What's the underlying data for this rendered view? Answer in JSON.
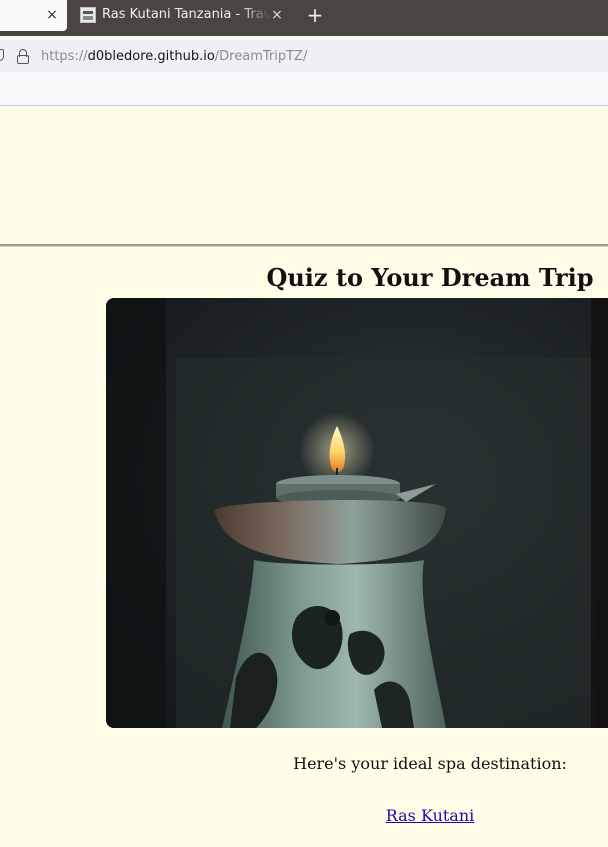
{
  "browser": {
    "active_tab_title": "Ras Kutani Tanzania - Travel",
    "close_glyph": "×",
    "new_tab_glyph": "+",
    "url_scheme": "https://",
    "url_host": "d0bledore.github.io",
    "url_path": "/DreamTripTZ/"
  },
  "page": {
    "title": "Quiz to Your Dream Trip",
    "result_text": "Here's your ideal spa destination:",
    "result_link": "Ras Kutani",
    "image": "candle-in-ceramic-oil-burner"
  },
  "colors": {
    "page_background": "#fffde8",
    "link": "#1a0dab",
    "tabbar": "#4a4542"
  }
}
